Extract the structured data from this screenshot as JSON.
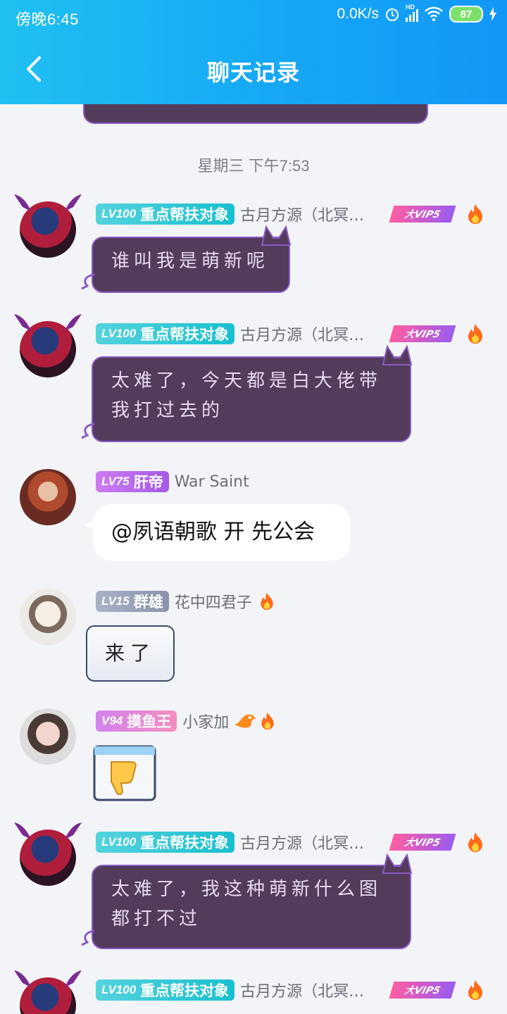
{
  "status": {
    "time": "傍晚6:45",
    "net_speed": "0.0K/s",
    "signal": "HD",
    "battery": "87"
  },
  "header": {
    "title": "聊天记录",
    "back_label": "<"
  },
  "timestamp": "星期三 下午7:53",
  "colors": {
    "header_start": "#1fc0f2",
    "header_end": "#1298f7",
    "dark_bubble": "#533b5b",
    "bubble_border": "#8a5bc7"
  },
  "messages": [
    {
      "badge": {
        "level": "LV100",
        "title": "重点帮扶对象"
      },
      "nick": "古月方源（北冥…",
      "vip": "大VIP5",
      "text": "谁叫我是萌新呢"
    },
    {
      "badge": {
        "level": "LV100",
        "title": "重点帮扶对象"
      },
      "nick": "古月方源（北冥…",
      "vip": "大VIP5",
      "line1": "太难了，今天都是白大佬带",
      "line2": "我打过去的"
    },
    {
      "badge": {
        "level": "LV75",
        "title": "肝帝"
      },
      "nick": "War Saint",
      "text": "@夙语朝歌 开 先公会"
    },
    {
      "badge": {
        "level": "LV15",
        "title": "群雄"
      },
      "nick": "花中四君子",
      "text": "来了"
    },
    {
      "badge": {
        "level": "V94",
        "title": "摸鱼王"
      },
      "nick": "小家加",
      "sticker": "thumbs-down"
    },
    {
      "badge": {
        "level": "LV100",
        "title": "重点帮扶对象"
      },
      "nick": "古月方源（北冥…",
      "vip": "大VIP5",
      "line1": "太难了，我这种萌新什么图",
      "line2": "都打不过"
    },
    {
      "badge": {
        "level": "LV100",
        "title": "重点帮扶对象"
      },
      "nick": "古月方源（北冥…",
      "vip": "大VIP5"
    }
  ]
}
